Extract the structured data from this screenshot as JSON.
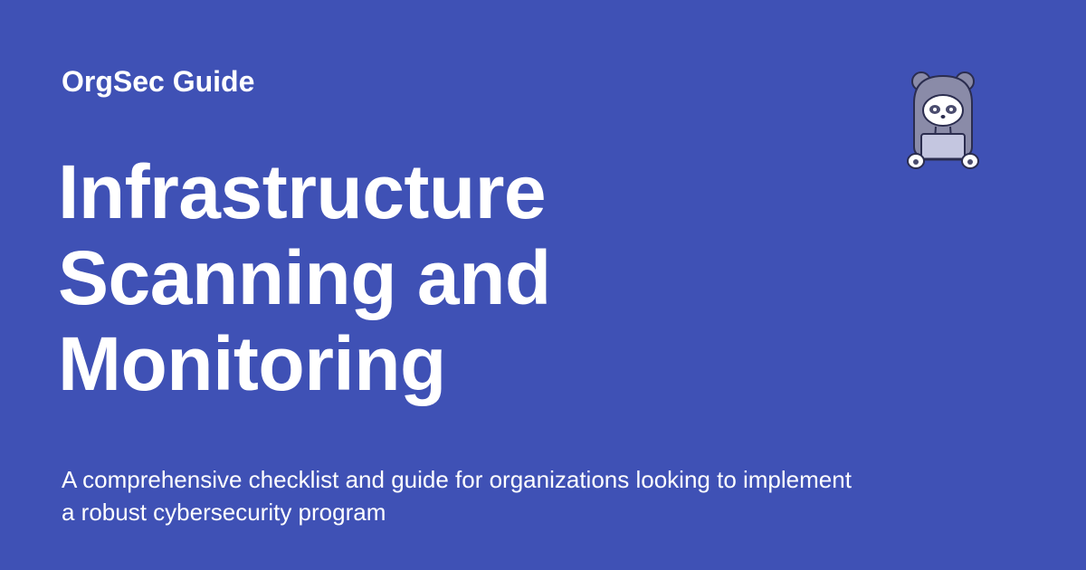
{
  "header": {
    "site_name": "OrgSec Guide"
  },
  "main": {
    "title_lines": [
      "Infrastructure",
      "Scanning and",
      "Monitoring"
    ],
    "subtitle": "A comprehensive checklist and guide for organizations looking to implement a robust cybersecurity program"
  },
  "mascot": {
    "icon": "hooded-panda-laptop-icon"
  },
  "colors": {
    "background": "#3f51b5",
    "text": "#ffffff"
  }
}
